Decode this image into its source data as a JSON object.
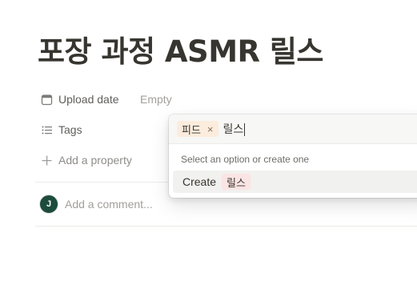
{
  "page": {
    "title": "포장 과정 ASMR 릴스"
  },
  "properties": [
    {
      "icon": "calendar-icon",
      "label": "Upload date",
      "value": "Empty"
    },
    {
      "icon": "list-icon",
      "label": "Tags"
    }
  ],
  "add_property": {
    "icon": "plus-icon",
    "label": "Add a property"
  },
  "comment": {
    "avatar_initial": "J",
    "placeholder": "Add a comment..."
  },
  "tags_popup": {
    "selected_tags": [
      {
        "label": "피드",
        "color": "#fbecdd"
      }
    ],
    "remove_glyph": "×",
    "input_value": "릴스",
    "hint": "Select an option or create one",
    "create_label": "Create",
    "create_option": {
      "label": "릴스",
      "color": "#fbe4e4"
    }
  }
}
